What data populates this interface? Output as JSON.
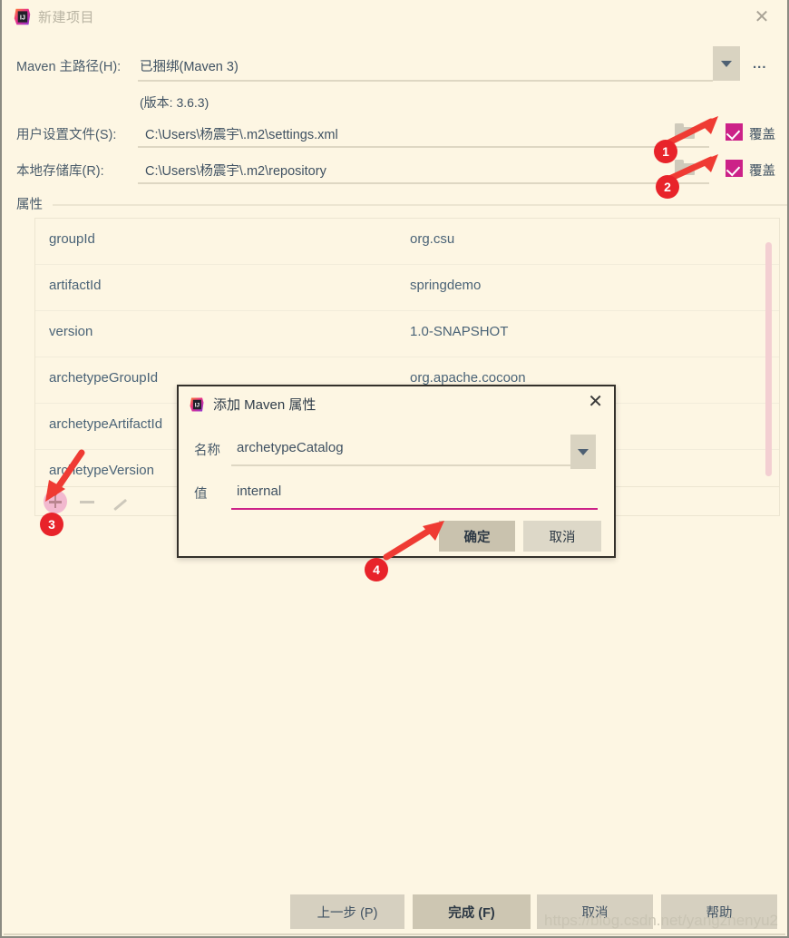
{
  "window": {
    "title": "新建项目",
    "icon": "intellij-idea-icon",
    "close_label": "✕"
  },
  "form": {
    "maven_home": {
      "label": "Maven 主路径(H):",
      "value": "已捆绑(Maven 3)",
      "dropdown_icon": "chevron-down-icon",
      "browse_label": "...",
      "version_note": "(版本: 3.6.3)"
    },
    "user_settings": {
      "label": "用户设置文件(S):",
      "value": "C:\\Users\\杨震宇\\.m2\\settings.xml",
      "browse_icon": "folder-icon",
      "override_label": "覆盖",
      "override_checked": true
    },
    "local_repo": {
      "label": "本地存储库(R):",
      "value": "C:\\Users\\杨震宇\\.m2\\repository",
      "browse_icon": "folder-icon",
      "override_label": "覆盖",
      "override_checked": true
    }
  },
  "properties": {
    "section_label": "属性",
    "rows": [
      {
        "key": "groupId",
        "value": "org.csu"
      },
      {
        "key": "artifactId",
        "value": "springdemo"
      },
      {
        "key": "version",
        "value": "1.0-SNAPSHOT"
      },
      {
        "key": "archetypeGroupId",
        "value": "org.apache.cocoon"
      },
      {
        "key": "archetypeArtifactId",
        "value": ""
      },
      {
        "key": "archetypeVersion",
        "value": ""
      }
    ],
    "toolbar": {
      "add_icon": "plus-icon",
      "remove_icon": "minus-icon",
      "edit_icon": "pencil-icon"
    }
  },
  "modal": {
    "icon": "intellij-idea-icon",
    "title": "添加 Maven 属性",
    "close_label": "✕",
    "name_label": "名称",
    "name_value": "archetypeCatalog",
    "name_dropdown_icon": "chevron-down-icon",
    "value_label": "值",
    "value_value": "internal",
    "ok_label": "确定",
    "cancel_label": "取消"
  },
  "footer": {
    "buttons": [
      {
        "label": "上一步 (P)",
        "style": "plain",
        "name": "previous-button"
      },
      {
        "label": "完成 (F)",
        "style": "def",
        "name": "finish-button"
      },
      {
        "label": "取消",
        "style": "plain",
        "name": "cancel-button"
      },
      {
        "label": "帮助",
        "style": "plain",
        "name": "help-button"
      }
    ]
  },
  "annotations": {
    "badges": [
      "1",
      "2",
      "3",
      "4"
    ]
  },
  "watermark": "https://blog.csdn.net/yangzhenyu2",
  "colors": {
    "background": "#fdf6e3",
    "checkbox": "#cc2288",
    "annotation_red": "#e8232a",
    "text": "#4a5c6b",
    "underline_accent": "#cc2288",
    "scrollbar": "#f3cfd2"
  }
}
